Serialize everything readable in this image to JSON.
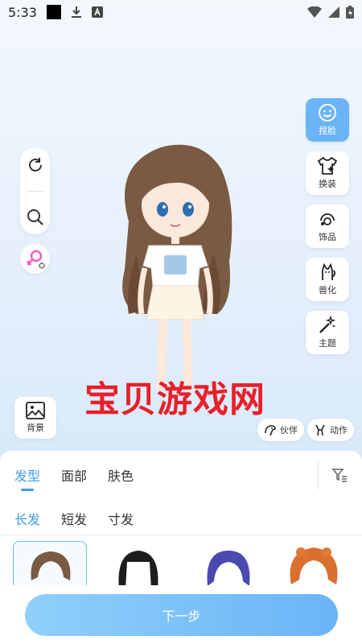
{
  "status_bar": {
    "time": "5:33"
  },
  "right_menu": [
    {
      "label": "捏脸",
      "icon": "face-icon",
      "active": true
    },
    {
      "label": "换装",
      "icon": "outfit-icon",
      "active": false
    },
    {
      "label": "饰品",
      "icon": "accessory-icon",
      "active": false
    },
    {
      "label": "兽化",
      "icon": "beast-icon",
      "active": false
    },
    {
      "label": "主题",
      "icon": "theme-wand-icon",
      "active": false
    }
  ],
  "left_tools": [
    "refresh-icon",
    "zoom-icon",
    "gender-switch-icon"
  ],
  "background_button": {
    "label": "背景"
  },
  "partner_button": {
    "label": "伙伴"
  },
  "action_button": {
    "label": "动作"
  },
  "watermark": "宝贝游戏网",
  "tabs": [
    {
      "label": "发型",
      "active": true
    },
    {
      "label": "面部",
      "active": false
    },
    {
      "label": "肤色",
      "active": false
    }
  ],
  "subtabs": [
    {
      "label": "长发",
      "active": true
    },
    {
      "label": "短发",
      "active": false
    },
    {
      "label": "寸发",
      "active": false
    }
  ],
  "hair_options": [
    {
      "color": "#7b5a43",
      "selected": true
    },
    {
      "color": "#1c1c1c",
      "selected": false
    },
    {
      "color": "#4a4ab0",
      "selected": false
    },
    {
      "color": "#d9702e",
      "selected": false
    }
  ],
  "next_button": {
    "label": "下一步"
  },
  "colors": {
    "accent": "#3d9be9",
    "button_gradient_start": "#8fd0fb",
    "button_gradient_end": "#6ab4f7"
  }
}
